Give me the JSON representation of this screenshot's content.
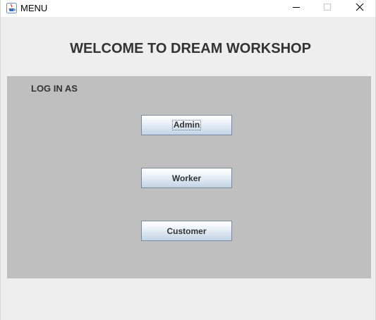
{
  "window": {
    "title": "MENU",
    "icon": "java-cup-icon",
    "controls": {
      "minimize_icon": "minimize-icon",
      "maximize_icon": "maximize-icon",
      "close_icon": "close-icon"
    }
  },
  "main": {
    "heading": "WELCOME TO DREAM WORKSHOP",
    "panel": {
      "label": "LOG IN AS",
      "background": "#bfbfbf",
      "buttons": [
        {
          "label": "Admin",
          "focused": true
        },
        {
          "label": "Worker",
          "focused": false
        },
        {
          "label": "Customer",
          "focused": false
        }
      ]
    }
  }
}
